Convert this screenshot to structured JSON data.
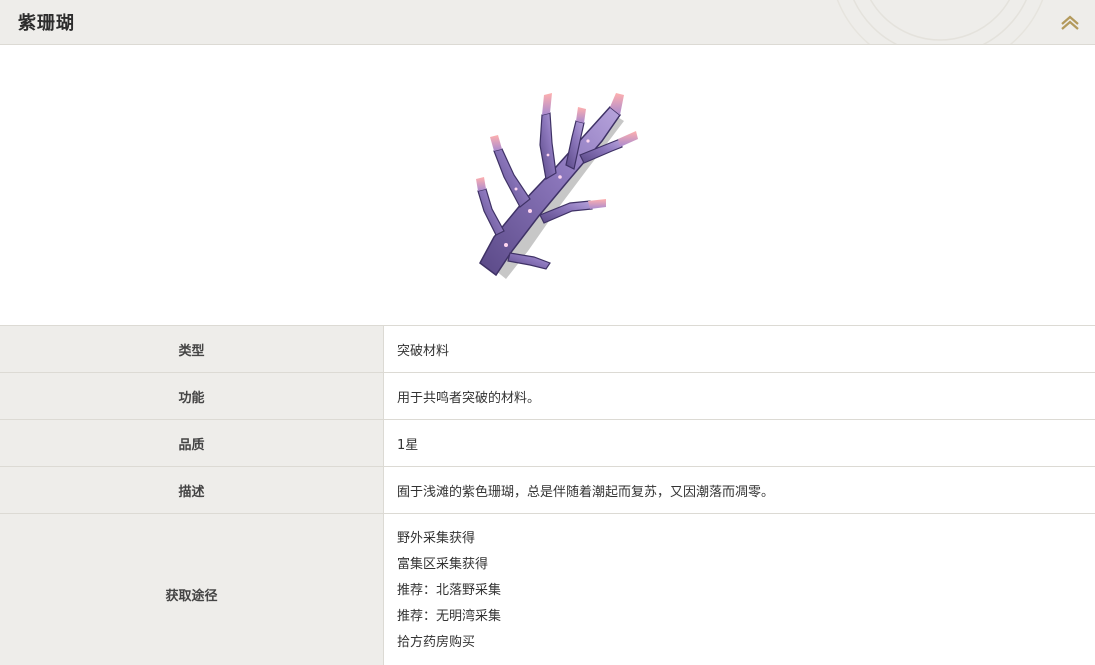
{
  "header": {
    "title": "紫珊瑚",
    "collapse_icon": "chevron-up-icon",
    "accent_color": "#b39a5c"
  },
  "item_image": {
    "icon": "purple-coral-image",
    "colors": {
      "stem": "#6c5a99",
      "stem_light": "#9f8ac9",
      "tips": "#f6a5a8"
    }
  },
  "info": {
    "rows": [
      {
        "label": "类型",
        "value": "突破材料"
      },
      {
        "label": "功能",
        "value": "用于共鸣者突破的材料。"
      },
      {
        "label": "品质",
        "value": "1星"
      },
      {
        "label": "描述",
        "value": "囿于浅滩的紫色珊瑚，总是伴随着潮起而复苏，又因潮落而凋零。"
      }
    ],
    "sources": {
      "label": "获取途径",
      "items": [
        "野外采集获得",
        "富集区采集获得",
        "推荐：北落野采集",
        "推荐：无明湾采集",
        "拾方药房购买"
      ]
    }
  }
}
